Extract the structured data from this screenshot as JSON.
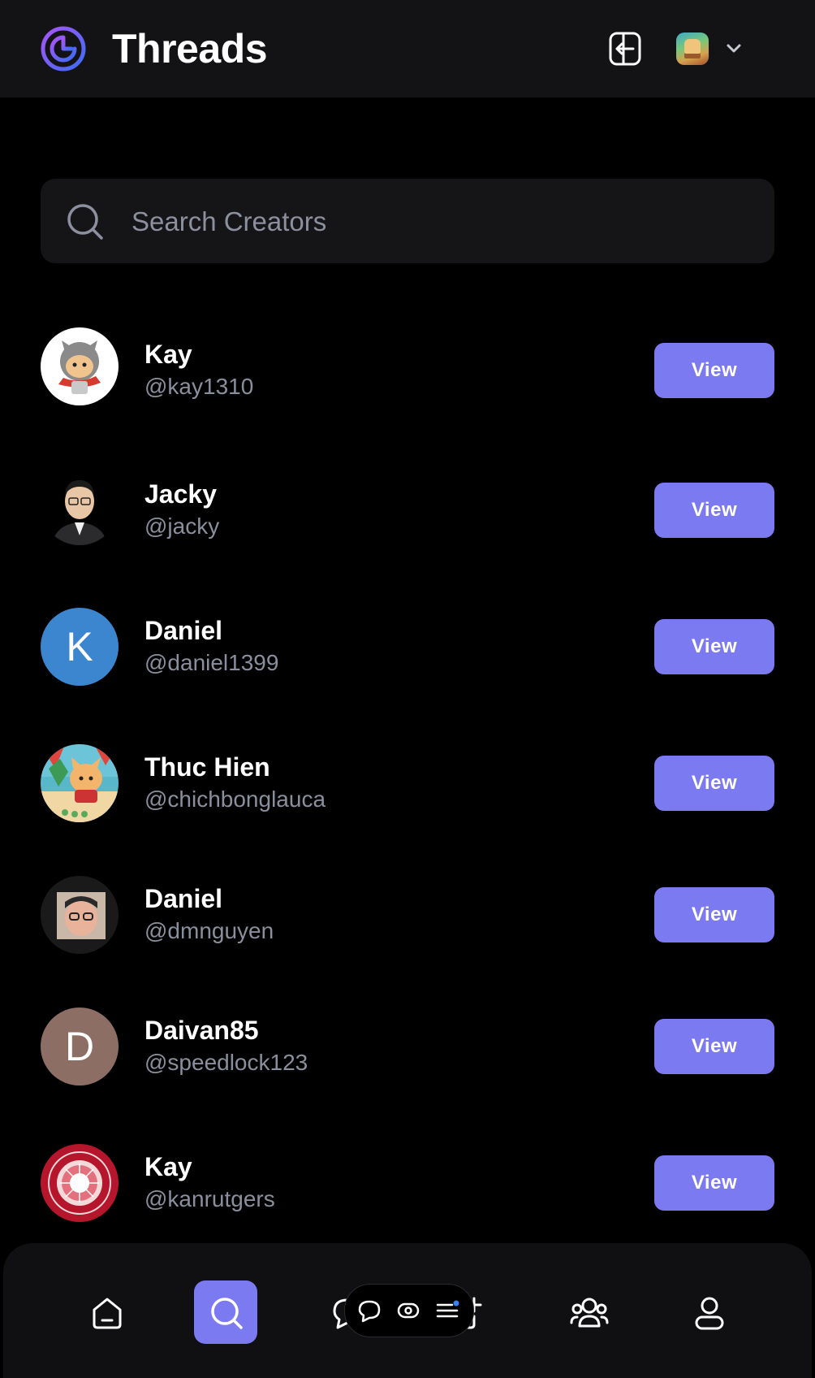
{
  "header": {
    "title": "Threads",
    "logo_icon": "threads-logo-icon",
    "logout_icon": "logout-icon",
    "dropdown_icon": "chevron-down-icon"
  },
  "search": {
    "placeholder": "Search Creators",
    "icon": "search-icon"
  },
  "creators": [
    {
      "name": "Kay",
      "handle": "@kay1310",
      "avatar": "cat-warrior-avatar",
      "button": "View"
    },
    {
      "name": "Jacky",
      "handle": "@jacky",
      "avatar": "photo-avatar",
      "button": "View"
    },
    {
      "name": "Daniel",
      "handle": "@daniel1399",
      "avatar_letter": "K",
      "avatar_color": "#3b86cf",
      "button": "View"
    },
    {
      "name": "Thuc Hien",
      "handle": "@chichbonglauca",
      "avatar": "cat-pool-avatar",
      "button": "View"
    },
    {
      "name": "Daniel",
      "handle": "@dmnguyen",
      "avatar": "photo-avatar",
      "button": "View"
    },
    {
      "name": "Daivan85",
      "handle": "@speedlock123",
      "avatar_letter": "D",
      "avatar_color": "#8c6e65",
      "button": "View"
    },
    {
      "name": "Kay",
      "handle": "@kanrutgers",
      "avatar": "university-seal-avatar",
      "button": "View"
    }
  ],
  "bottom_nav": {
    "items": [
      "home-icon",
      "search-icon",
      "chat-icon",
      "compose-icon",
      "community-icon",
      "profile-icon"
    ],
    "active": "search-icon",
    "floating_bar": [
      "chat-bubble-icon",
      "eye-icon",
      "menu-icon"
    ]
  },
  "colors": {
    "accent": "#7c7af0",
    "background": "#000000",
    "header": "#131316",
    "muted_text": "#8a8f9d"
  }
}
